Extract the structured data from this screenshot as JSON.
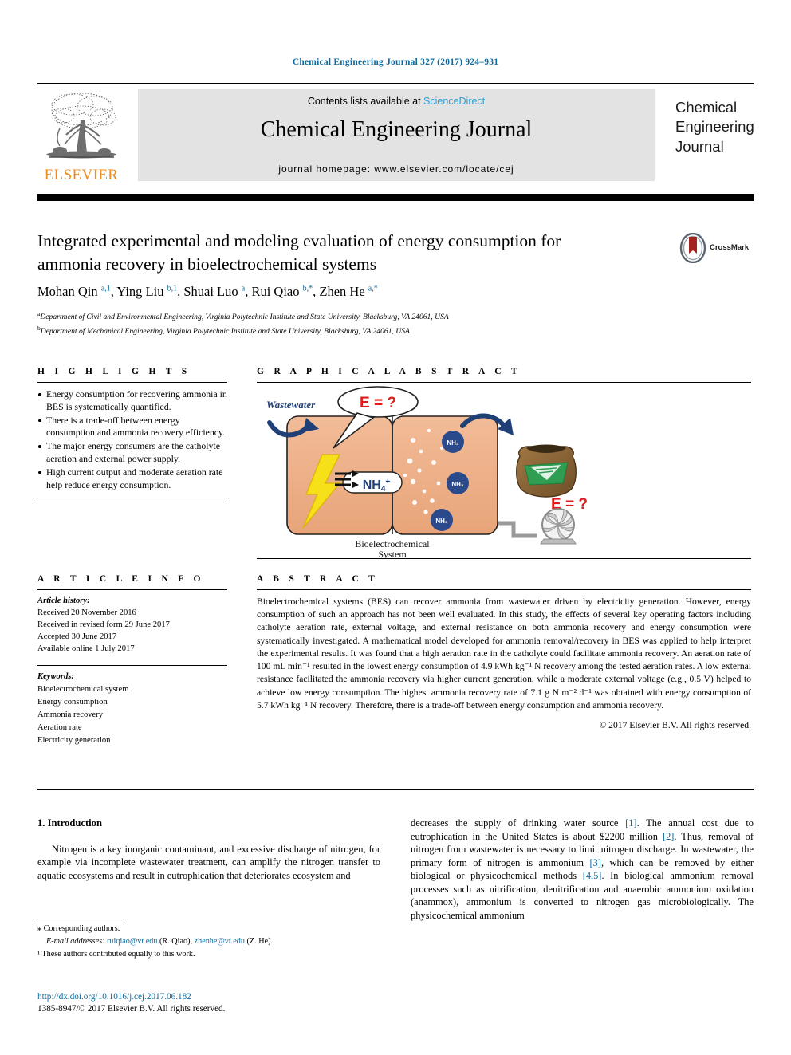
{
  "running_head": "Chemical Engineering Journal 327 (2017) 924–931",
  "masthead": {
    "contents_prefix": "Contents lists available at ",
    "sciencedirect": "ScienceDirect",
    "journal_title": "Chemical Engineering Journal",
    "homepage": "journal homepage: www.elsevier.com/locate/cej",
    "publisher_wordmark": "ELSEVIER",
    "publisher_logo_icon": "elsevier-tree-icon",
    "cover_line_1": "Chemical",
    "cover_line_2": "Engineering",
    "cover_line_3": "Journal",
    "link_color": "#2a9fd6",
    "brand_orange": "#f08a1e"
  },
  "article": {
    "title": "Integrated experimental and modeling evaluation of energy consumption for ammonia recovery in bioelectrochemical systems",
    "crossmark_label": "CrossMark",
    "crossmark_icon": "crossmark-badge-icon",
    "authors_html": "Mohan Qin <sup>a,1</sup>, Ying Liu <sup>b,1</sup>, Shuai Luo <sup>a</sup>, Rui Qiao <sup>b,*</sup>, Zhen He <sup>a,*</sup>",
    "affiliations": [
      "Department of Civil and Environmental Engineering, Virginia Polytechnic Institute and State University, Blacksburg, VA 24061, USA",
      "Department of Mechanical Engineering, Virginia Polytechnic Institute and State University, Blacksburg, VA 24061, USA"
    ],
    "affiliation_marks": [
      "a",
      "b"
    ]
  },
  "highlights": {
    "heading": "H I G H L I G H T S",
    "items": [
      "Energy consumption for recovering ammonia in BES is systematically quantified.",
      "There is a trade-off between energy consumption and ammonia recovery efficiency.",
      "The major energy consumers are the catholyte aeration and external power supply.",
      "High current output and moderate aeration rate help reduce energy consumption."
    ]
  },
  "graphical_abstract": {
    "heading": "G R A P H I C A L   A B S T R A C T",
    "labels": {
      "wastewater": "Wastewater",
      "energy_question_top": "E = ?",
      "energy_question_bottom": "E = ?",
      "ion_label": "NH",
      "ion_sub": "4",
      "ion_sup": "+",
      "bubble_1": "NH₃",
      "bubble_2": "NH₃",
      "bubble_3": "NH₃",
      "caption_line_1": "Bioelectrochemical",
      "caption_line_2": "System"
    },
    "icons": {
      "arrow_in": "curved-arrow-icon",
      "arrow_out": "curved-arrow-icon",
      "lightning": "lightning-bolt-icon",
      "fertilizer_bag": "fertilizer-bag-icon",
      "air_pump": "air-pump-fan-icon",
      "speech_bubble": "speech-bubble-icon"
    },
    "colors": {
      "reactor_fill": "#eeb18a",
      "arrow_navy": "#1f3f77",
      "bolt_yellow": "#f5e019",
      "red": "#e21b1b",
      "bubble_blue": "#2b4a8b",
      "bag_brown": "#8c6239",
      "bag_green": "#2f9e52",
      "pump_gray": "#9a9a9a"
    }
  },
  "article_info": {
    "heading": "A R T I C L E   I N F O",
    "history_label": "Article history:",
    "history": [
      "Received 20 November 2016",
      "Received in revised form 29 June 2017",
      "Accepted 30 June 2017",
      "Available online 1 July 2017"
    ],
    "keywords_label": "Keywords:",
    "keywords": [
      "Bioelectrochemical system",
      "Energy consumption",
      "Ammonia recovery",
      "Aeration rate",
      "Electricity generation"
    ]
  },
  "abstract": {
    "heading": "A B S T R A C T",
    "text": "Bioelectrochemical systems (BES) can recover ammonia from wastewater driven by electricity generation. However, energy consumption of such an approach has not been well evaluated. In this study, the effects of several key operating factors including catholyte aeration rate, external voltage, and external resistance on both ammonia recovery and energy consumption were systematically investigated. A mathematical model developed for ammonia removal/recovery in BES was applied to help interpret the experimental results. It was found that a high aeration rate in the catholyte could facilitate ammonia recovery. An aeration rate of 100 mL min⁻¹ resulted in the lowest energy consumption of 4.9 kWh kg⁻¹ N recovery among the tested aeration rates. A low external resistance facilitated the ammonia recovery via higher current generation, while a moderate external voltage (e.g., 0.5 V) helped to achieve low energy consumption. The highest ammonia recovery rate of 7.1 g N m⁻² d⁻¹ was obtained with energy consumption of 5.7 kWh kg⁻¹ N recovery. Therefore, there is a trade-off between energy consumption and ammonia recovery.",
    "copyright": "© 2017 Elsevier B.V. All rights reserved."
  },
  "body": {
    "section_heading": "1. Introduction",
    "left_paragraph": "Nitrogen is a key inorganic contaminant, and excessive discharge of nitrogen, for example via incomplete wastewater treatment, can amplify the nitrogen transfer to aquatic ecosystems and result in eutrophication that deteriorates ecosystem and",
    "right_paragraph_parts": [
      "decreases the supply of drinking water source ",
      "[1]",
      ". The annual cost due to eutrophication in the United States is about $2200 million ",
      "[2]",
      ". Thus, removal of nitrogen from wastewater is necessary to limit nitrogen discharge. In wastewater, the primary form of nitrogen is ammonium ",
      "[3]",
      ", which can be removed by either biological or physicochemical methods ",
      "[4,5]",
      ". In biological ammonium removal processes such as nitrification, denitrification and anaerobic ammonium oxidation (anammox), ammonium is converted to nitrogen gas microbiologically. The physicochemical ammonium"
    ]
  },
  "footnotes": {
    "corresponding": "⁎ Corresponding authors.",
    "email_label": "E-mail addresses:",
    "email_1": "ruiqiao@vt.edu",
    "email_1_owner": " (R. Qiao), ",
    "email_2": "zhenhe@vt.edu",
    "email_2_owner": " (Z. He).",
    "equal_contrib": "¹ These authors contributed equally to this work."
  },
  "imprint": {
    "doi": "http://dx.doi.org/10.1016/j.cej.2017.06.182",
    "issn_line": "1385-8947/© 2017 Elsevier B.V. All rights reserved."
  }
}
